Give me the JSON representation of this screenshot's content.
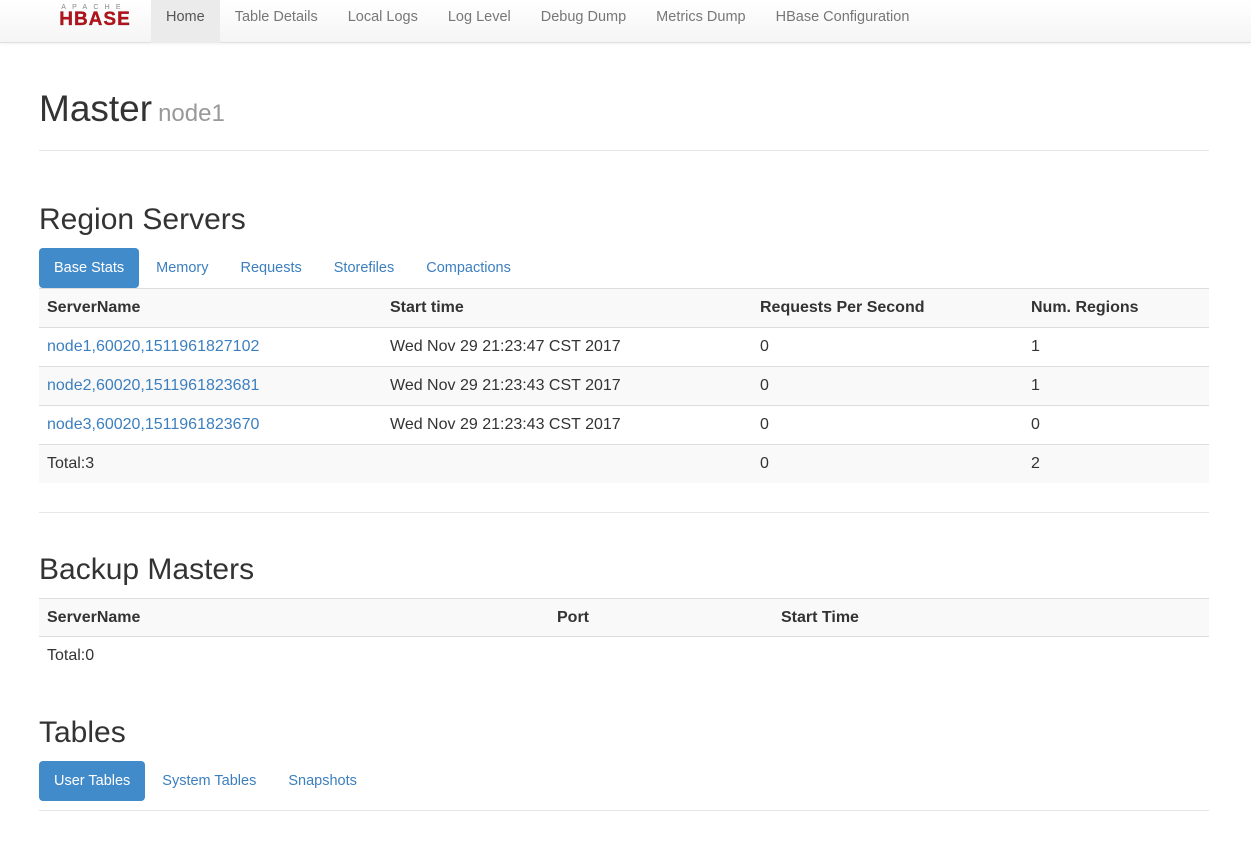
{
  "logo": {
    "top_text": "APACHE",
    "main_text": "HBASE"
  },
  "nav": {
    "items": [
      {
        "label": "Home",
        "active": true
      },
      {
        "label": "Table Details"
      },
      {
        "label": "Local Logs"
      },
      {
        "label": "Log Level"
      },
      {
        "label": "Debug Dump"
      },
      {
        "label": "Metrics Dump"
      },
      {
        "label": "HBase Configuration"
      }
    ]
  },
  "header": {
    "title": "Master",
    "subtitle": "node1"
  },
  "region_servers": {
    "title": "Region Servers",
    "tabs": [
      "Base Stats",
      "Memory",
      "Requests",
      "Storefiles",
      "Compactions"
    ],
    "columns": [
      "ServerName",
      "Start time",
      "Requests Per Second",
      "Num. Regions"
    ],
    "rows": [
      {
        "server": "node1,60020,1511961827102",
        "start": "Wed Nov 29 21:23:47 CST 2017",
        "rps": "0",
        "regions": "1"
      },
      {
        "server": "node2,60020,1511961823681",
        "start": "Wed Nov 29 21:23:43 CST 2017",
        "rps": "0",
        "regions": "1"
      },
      {
        "server": "node3,60020,1511961823670",
        "start": "Wed Nov 29 21:23:43 CST 2017",
        "rps": "0",
        "regions": "0"
      }
    ],
    "total": {
      "label": "Total:3",
      "rps": "0",
      "regions": "2"
    }
  },
  "backup_masters": {
    "title": "Backup Masters",
    "columns": [
      "ServerName",
      "Port",
      "Start Time"
    ],
    "total": "Total:0"
  },
  "tables": {
    "title": "Tables",
    "tabs": [
      "User Tables",
      "System Tables",
      "Snapshots"
    ]
  }
}
